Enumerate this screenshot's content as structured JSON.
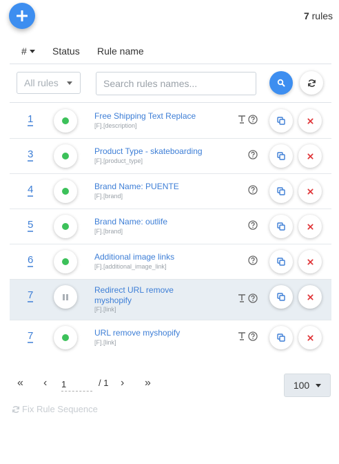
{
  "header": {
    "rules_count": "7",
    "rules_word": "rules",
    "col_number": "#",
    "col_status": "Status",
    "col_name": "Rule name"
  },
  "filter": {
    "select_value": "All rules",
    "search_placeholder": "Search rules names..."
  },
  "rows": [
    {
      "number": "1",
      "status": "active",
      "name": "Free Shipping Text Replace",
      "field": "[F].[description]",
      "icons": [
        "text-transform-icon",
        "help-icon"
      ]
    },
    {
      "number": "3",
      "status": "active",
      "name": "Product Type - skateboarding",
      "field": "[F].[product_type]",
      "icons": [
        "help-icon"
      ]
    },
    {
      "number": "4",
      "status": "active",
      "name": "Brand Name: PUENTE",
      "field": "[F].[brand]",
      "icons": [
        "help-icon"
      ]
    },
    {
      "number": "5",
      "status": "active",
      "name": "Brand Name: outlife",
      "field": "[F].[brand]",
      "icons": [
        "help-icon"
      ]
    },
    {
      "number": "6",
      "status": "active",
      "name": "Additional image links",
      "field": "[F].[additional_image_link]",
      "icons": [
        "help-icon"
      ]
    },
    {
      "number": "7",
      "status": "paused",
      "name": "Redirect URL remove myshopify",
      "field": "[F].[link]",
      "icons": [
        "text-transform-icon",
        "help-icon"
      ]
    },
    {
      "number": "7",
      "status": "active",
      "name": "URL remove myshopify",
      "field": "[F].[link]",
      "icons": [
        "text-transform-icon",
        "help-icon"
      ]
    }
  ],
  "pagination": {
    "current_page": "1",
    "total_pages": "/ 1",
    "per_page": "100"
  },
  "footer": {
    "fix_sequence_label": "Fix Rule Sequence"
  },
  "colors": {
    "accent": "#3d8ef0",
    "link": "#3d7ed6",
    "active_dot": "#3cc15a",
    "delete": "#e0383b",
    "highlight_row": "#e8eef3"
  }
}
